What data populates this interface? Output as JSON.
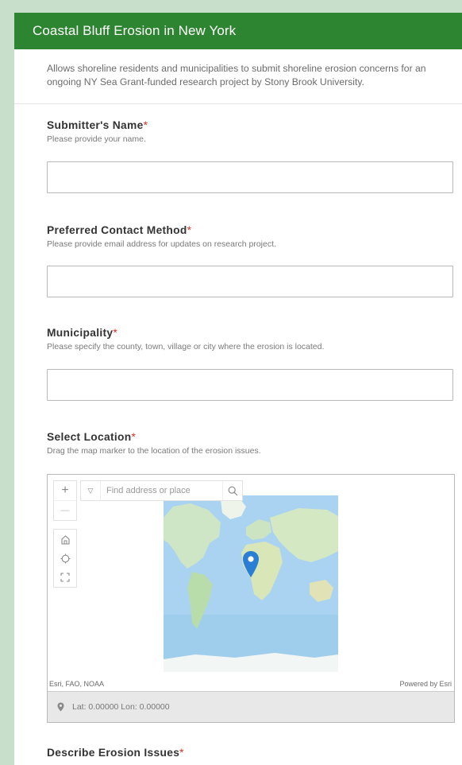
{
  "header": {
    "title": "Coastal Bluff Erosion in New York"
  },
  "description": "Allows shoreline residents and municipalities to submit shoreline erosion concerns for an ongoing NY Sea Grant-funded research project by Stony Brook University.",
  "fields": {
    "name": {
      "label": "Submitter's Name",
      "required": "*",
      "hint": "Please provide your name.",
      "value": ""
    },
    "contact": {
      "label": "Preferred Contact Method",
      "required": "*",
      "hint": "Please provide email address for updates on research project.",
      "value": ""
    },
    "municipality": {
      "label": "Municipality",
      "required": "*",
      "hint": "Please specify the county, town, village or city where the erosion is located.",
      "value": ""
    },
    "location": {
      "label": "Select Location",
      "required": "*",
      "hint": "Drag the map marker to the location of the erosion issues."
    },
    "describe": {
      "label": "Describe Erosion Issues",
      "required": "*"
    }
  },
  "map": {
    "search_placeholder": "Find address or place",
    "zoom_in": "+",
    "zoom_out": "—",
    "attribution": "Esri, FAO, NOAA",
    "powered_by": "Powered by Esri",
    "coordinates": "Lat: 0.00000  Lon: 0.00000",
    "icons": [
      "zoom-in-icon",
      "zoom-out-icon",
      "home-icon",
      "locate-icon",
      "fullscreen-icon",
      "search-icon",
      "pin-icon",
      "marker-icon"
    ],
    "marker_color": "#2a7fd4"
  },
  "colors": {
    "header": "#2e8531",
    "required": "#d83020",
    "page_border": "#c8dfcc"
  }
}
